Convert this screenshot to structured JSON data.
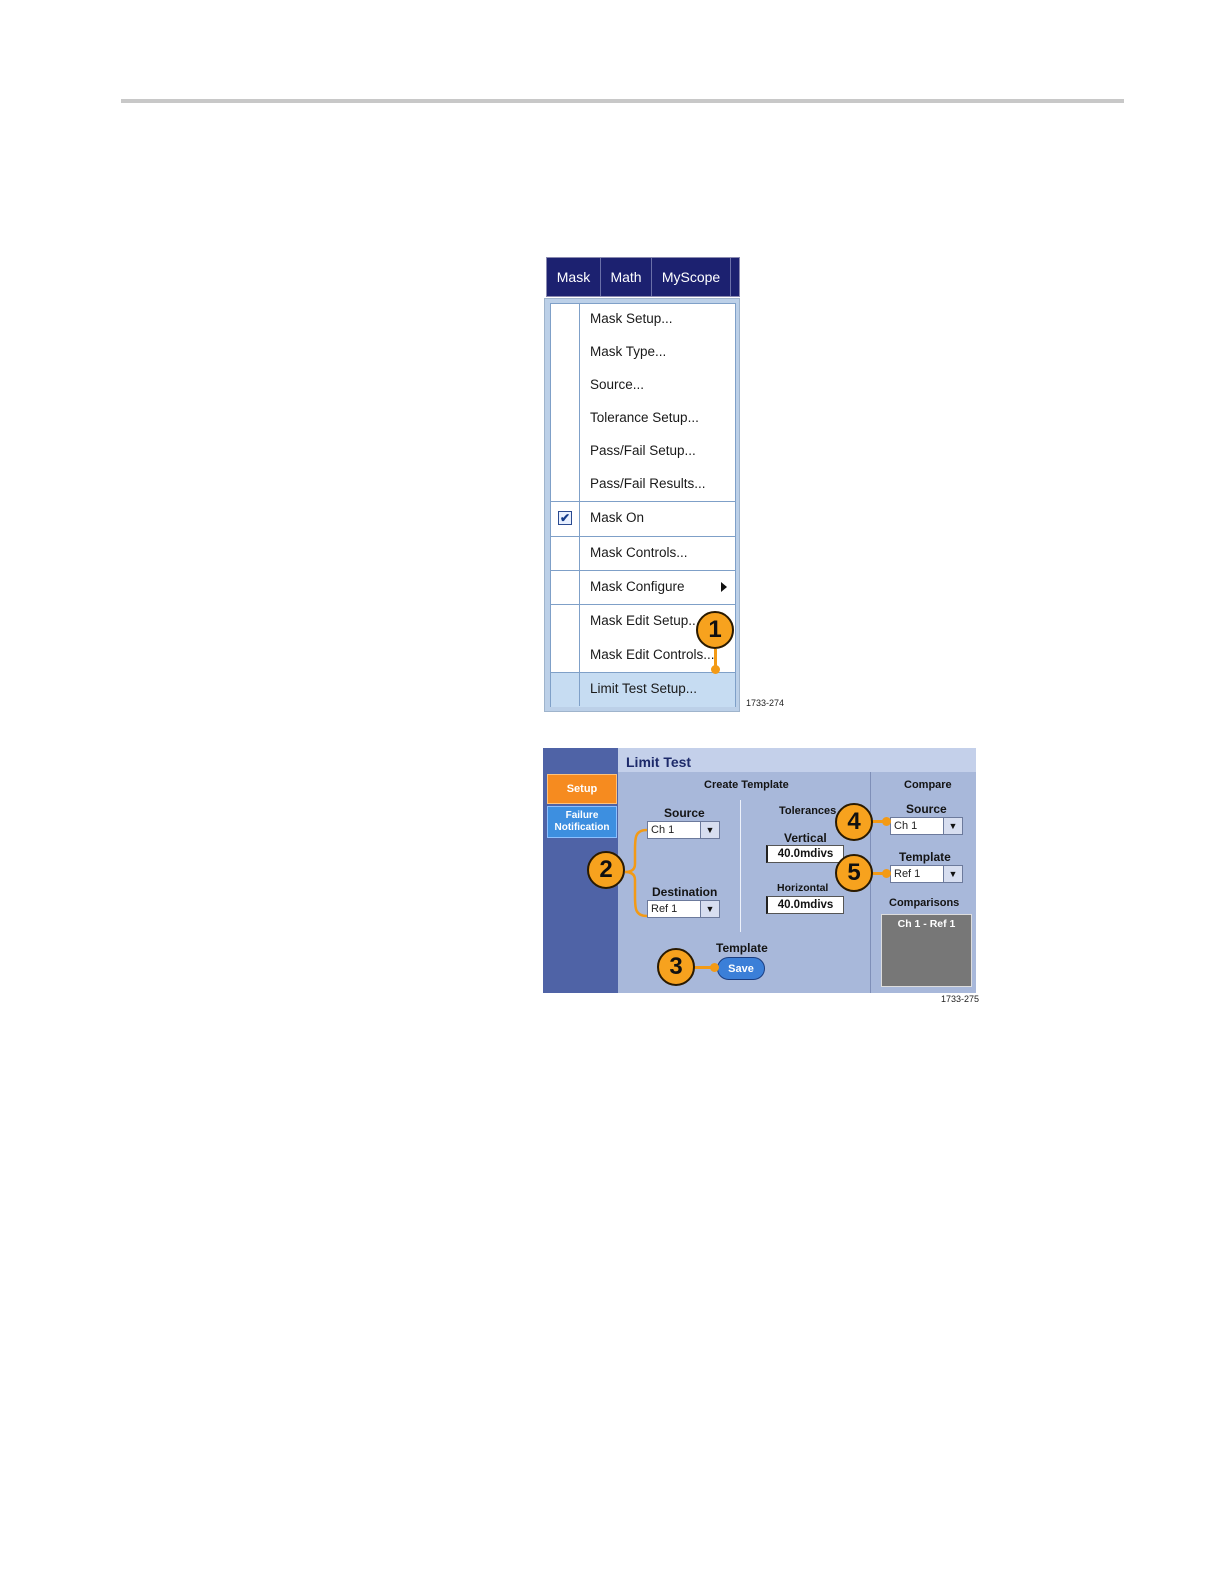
{
  "menubar": {
    "tabs": [
      "Mask",
      "Math",
      "MyScope"
    ]
  },
  "mask_menu": {
    "items": [
      {
        "label": "Mask Setup..."
      },
      {
        "label": "Mask Type..."
      },
      {
        "label": "Source..."
      },
      {
        "label": "Tolerance Setup..."
      },
      {
        "label": "Pass/Fail Setup..."
      },
      {
        "label": "Pass/Fail Results..."
      },
      {
        "label": "Mask On",
        "checked": true
      },
      {
        "label": "Mask Controls..."
      },
      {
        "label": "Mask Configure",
        "submenu": true
      },
      {
        "label": "Mask Edit Setup..."
      },
      {
        "label": "Mask Edit Controls..."
      },
      {
        "label": "Limit Test Setup...",
        "highlighted": true
      }
    ],
    "check_mark": "✔",
    "figure_id": "1733-274"
  },
  "limit_test": {
    "title": "Limit Test",
    "tabs": {
      "setup": "Setup",
      "failure_line1": "Failure",
      "failure_line2": "Notification"
    },
    "create_template": {
      "heading": "Create Template",
      "source_label": "Source",
      "source_value": "Ch 1",
      "destination_label": "Destination",
      "destination_value": "Ref 1",
      "tolerances_label": "Tolerances",
      "vertical_label": "Vertical",
      "vertical_value": "40.0mdivs",
      "horizontal_label": "Horizontal",
      "horizontal_value": "40.0mdivs",
      "template_label": "Template",
      "save_label": "Save"
    },
    "compare": {
      "heading": "Compare",
      "source_label": "Source",
      "source_value": "Ch 1",
      "template_label": "Template",
      "template_value": "Ref 1",
      "comparisons_label": "Comparisons",
      "comparisons": [
        "Ch 1 - Ref 1"
      ]
    },
    "dropdown_arrow": "▼",
    "figure_id": "1733-275"
  },
  "callouts": [
    "1",
    "2",
    "3",
    "4",
    "5"
  ],
  "colors": {
    "menubar": "#1c2170",
    "callout": "#f7a21e",
    "setup_tab": "#f68b1f",
    "panel": "#a8b8da"
  }
}
